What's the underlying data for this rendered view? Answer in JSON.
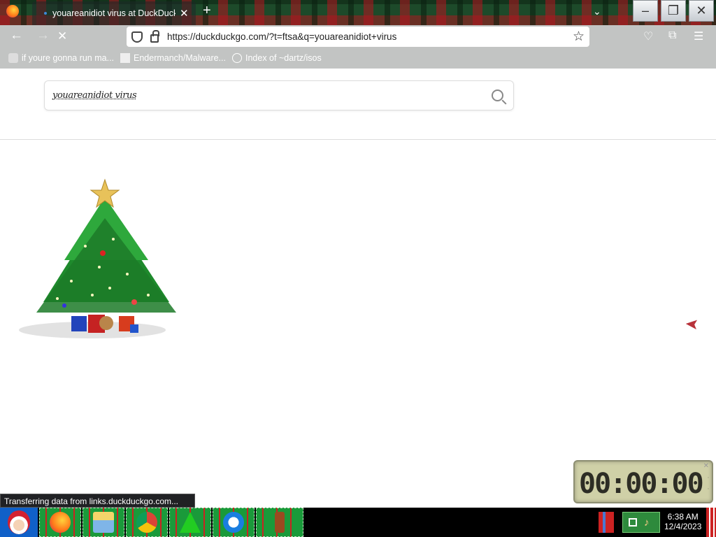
{
  "browser": {
    "tab_title": "youareanidiot virus at DuckDuckGo",
    "url": "https://duckduckgo.com/?t=ftsa&q=youareanidiot+virus",
    "bookmarks": [
      {
        "label": "if youre gonna run ma...",
        "icon": "bookmark-page-icon"
      },
      {
        "label": "Endermanch/Malware...",
        "icon": "github-icon"
      },
      {
        "label": "Index of ~dartz/isos",
        "icon": "globe-icon"
      }
    ]
  },
  "page": {
    "search_query": "youareanidiot virus"
  },
  "status": {
    "text": "Transferring data from links.duckduckgo.com..."
  },
  "clock_widget": {
    "display": "00:00:00"
  },
  "taskbar": {
    "time": "6:38 AM",
    "date": "12/4/2023",
    "apps": [
      "firefox-icon",
      "file-explorer-icon",
      "chrome-icon",
      "christmas-tree-icon",
      "messenger-icon",
      "reindeer-icon"
    ]
  },
  "colors": {
    "plaid_green": "#1d4a2a",
    "plaid_red": "#b4141e",
    "start_blue": "#1060c8",
    "taskbar_green": "#1a9a3a"
  }
}
